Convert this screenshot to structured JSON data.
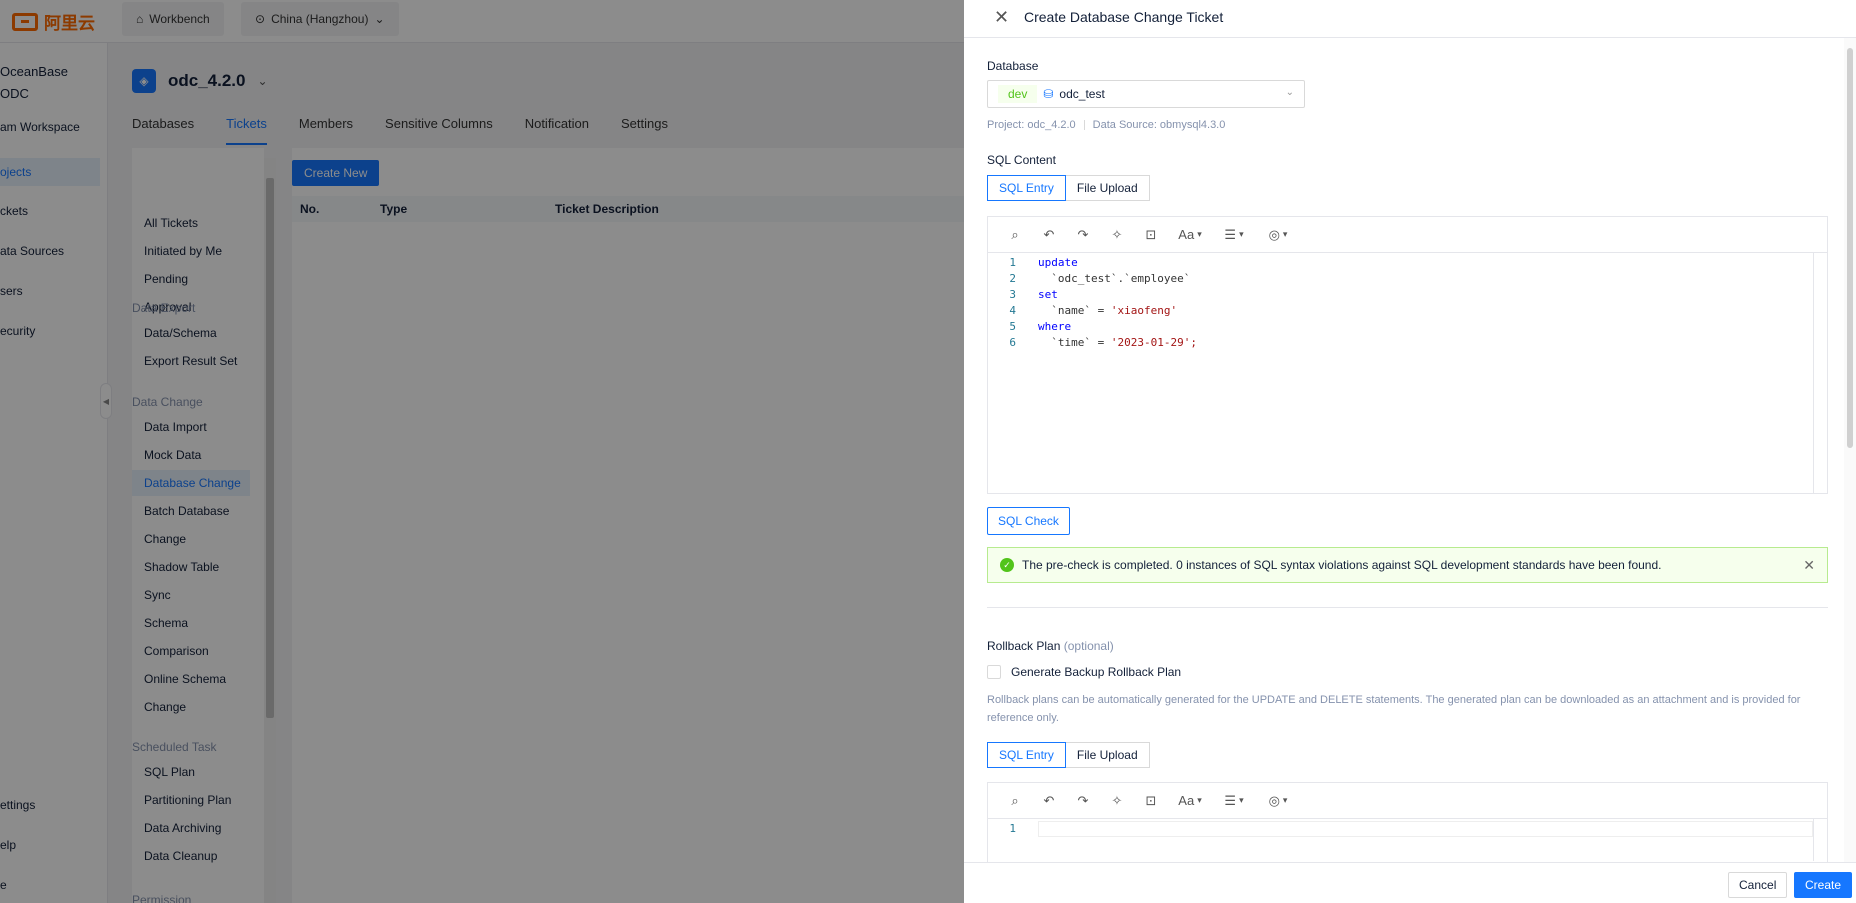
{
  "topbar": {
    "logo_text": "阿里云",
    "workbench_label": "Workbench",
    "region_label": "China (Hangzhou)"
  },
  "sidebar": {
    "title_line1": "OceanBase",
    "title_line2": "ODC",
    "items": [
      {
        "label": "am Workspace"
      },
      {
        "label": "ojects"
      },
      {
        "label": "ckets"
      },
      {
        "label": "ata Sources"
      },
      {
        "label": "sers"
      },
      {
        "label": "ecurity"
      },
      {
        "label": "ettings"
      },
      {
        "label": "elp"
      },
      {
        "label": "e"
      }
    ]
  },
  "project": {
    "name": "odc_4.2.0",
    "tabs": [
      "Databases",
      "Tickets",
      "Members",
      "Sensitive Columns",
      "Notification",
      "Settings"
    ]
  },
  "tickets_menu": {
    "items_top": [
      "All Tickets",
      "Initiated by Me",
      "Pending",
      "Approval"
    ],
    "group_export": "Data Export",
    "items_export": [
      "Data/Schema",
      "Export Result Set"
    ],
    "group_change": "Data Change",
    "items_change": [
      "Data Import",
      "Mock Data",
      "Database Change",
      "Batch Database",
      "Change",
      "Shadow Table",
      "Sync",
      "Schema",
      "Comparison",
      "Online Schema",
      "Change"
    ],
    "group_scheduled": "Scheduled Task",
    "items_scheduled": [
      "SQL Plan",
      "Partitioning Plan",
      "Data Archiving",
      "Data Cleanup"
    ],
    "group_permission": "Permission"
  },
  "tickets_table": {
    "create_new": "Create New",
    "columns": [
      "No.",
      "Type",
      "Ticket Description"
    ]
  },
  "drawer": {
    "title": "Create Database Change Ticket",
    "database_label": "Database",
    "env_tag": "dev",
    "database_value": "odc_test",
    "project_meta": "Project: odc_4.2.0",
    "datasource_meta": "Data Source: obmysql4.3.0",
    "sql_content_label": "SQL Content",
    "seg_sql_entry": "SQL Entry",
    "seg_file_upload": "File Upload",
    "code_lines": [
      {
        "n": "1",
        "kw": "update",
        "rest": "",
        "str": ""
      },
      {
        "n": "2",
        "kw": "",
        "rest": "  `odc_test`.`employee`",
        "str": ""
      },
      {
        "n": "3",
        "kw": "set",
        "rest": "",
        "str": ""
      },
      {
        "n": "4",
        "kw": "",
        "rest": "  `name` = ",
        "str": "'xiaofeng'"
      },
      {
        "n": "5",
        "kw": "where",
        "rest": "",
        "str": ""
      },
      {
        "n": "6",
        "kw": "",
        "rest": "  `time` = ",
        "str": "'2023-01-29';"
      }
    ],
    "sql_check_label": "SQL Check",
    "alert_text": "The pre-check is completed. 0 instances of SQL syntax violations against SQL development standards have been found.",
    "rollback_label": "Rollback Plan",
    "rollback_optional": "(optional)",
    "rollback_checkbox": "Generate Backup Rollback Plan",
    "rollback_help": "Rollback plans can be automatically generated for the UPDATE and DELETE statements. The generated plan can be downloaded as an attachment and is provided for reference only.",
    "rollback_line_no": "1",
    "cancel_label": "Cancel",
    "create_label": "Create"
  },
  "colors": {
    "primary": "#1677ff",
    "success_bg": "#f6ffed",
    "success": "#52c41a",
    "overlay": "rgba(0,0,0,0.45)"
  },
  "icons": {
    "toolbar": [
      "find-icon",
      "undo-icon",
      "redo-icon",
      "format-icon",
      "snippet-icon",
      "case-icon",
      "indent-icon",
      "more-icon"
    ]
  }
}
